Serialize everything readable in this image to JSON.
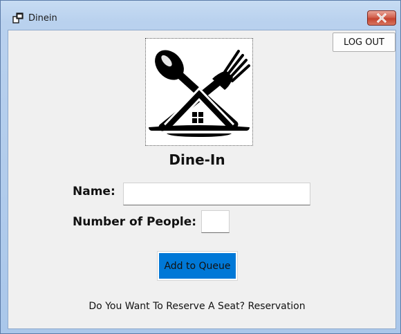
{
  "window": {
    "title": "Dinein",
    "close_glyph": "✕",
    "icon": "app-window-icon"
  },
  "header": {
    "logout_label": "LOG OUT"
  },
  "logo": {
    "icon": "dine-in-logo-icon"
  },
  "form": {
    "heading": "Dine-In",
    "name_label": "Name:",
    "name_value": "",
    "people_label": "Number of People:",
    "people_value": "",
    "submit_label": "Add to Queue"
  },
  "footer": {
    "reserve_prompt": "Do You Want To Reserve A Seat?",
    "reserve_link": "Reservation"
  },
  "colors": {
    "primary_button": "#0078d7",
    "close_button": "#c4432f",
    "window_frame": "#aac7ea",
    "client_background": "#f0f0f0"
  }
}
